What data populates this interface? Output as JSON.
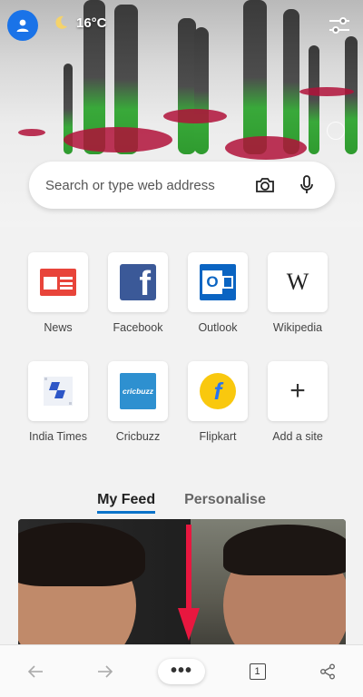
{
  "header": {
    "weather": {
      "temperature": "16°C",
      "icon": "moon-icon"
    },
    "avatar_icon": "person-icon",
    "settings_icon": "sliders-icon"
  },
  "search": {
    "placeholder": "Search or type web address",
    "camera_icon": "camera-icon",
    "mic_icon": "microphone-icon"
  },
  "quick_links": [
    {
      "label": "News",
      "icon": "news-icon"
    },
    {
      "label": "Facebook",
      "icon": "facebook-icon"
    },
    {
      "label": "Outlook",
      "icon": "outlook-icon"
    },
    {
      "label": "Wikipedia",
      "icon": "wikipedia-icon"
    },
    {
      "label": "India Times",
      "icon": "india-times-icon"
    },
    {
      "label": "Cricbuzz",
      "icon": "cricbuzz-icon"
    },
    {
      "label": "Flipkart",
      "icon": "flipkart-icon"
    },
    {
      "label": "Add a site",
      "icon": "plus-icon"
    }
  ],
  "tile_glyphs": {
    "wikipedia": "W",
    "cricbuzz": "cricbuzz",
    "facebook": "f",
    "flipkart": "f",
    "outlook": "O",
    "plus": "+"
  },
  "feed": {
    "tabs": [
      {
        "label": "My Feed",
        "active": true
      },
      {
        "label": "Personalise",
        "active": false
      }
    ]
  },
  "bottom_nav": {
    "back_icon": "back-arrow-icon",
    "forward_icon": "forward-arrow-icon",
    "more_label": "•••",
    "tab_count": "1",
    "share_icon": "share-icon"
  },
  "colors": {
    "accent": "#0b73c9",
    "avatar": "#1a73e8",
    "annotation_arrow": "#e8173f"
  }
}
